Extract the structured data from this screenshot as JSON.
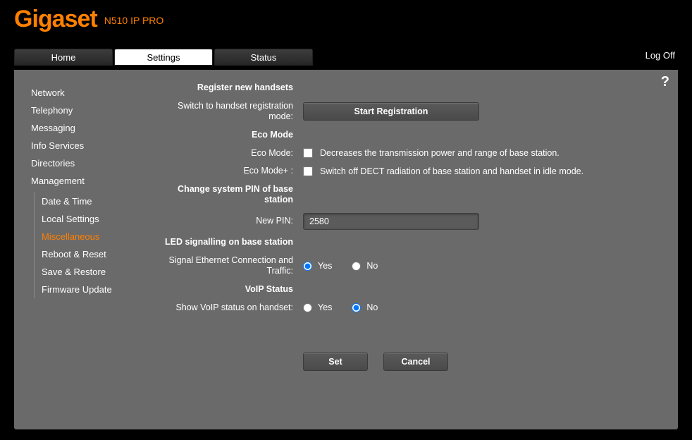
{
  "brand": "Gigaset",
  "model": "N510 IP PRO",
  "tabs": {
    "home": "Home",
    "settings": "Settings",
    "status": "Status"
  },
  "logoff": "Log Off",
  "help": "?",
  "sidebar": {
    "network": "Network",
    "telephony": "Telephony",
    "messaging": "Messaging",
    "info_services": "Info Services",
    "directories": "Directories",
    "management": "Management",
    "sub": {
      "date_time": "Date & Time",
      "local_settings": "Local Settings",
      "miscellaneous": "Miscellaneous",
      "reboot_reset": "Reboot & Reset",
      "save_restore": "Save & Restore",
      "firmware_update": "Firmware Update"
    }
  },
  "sections": {
    "register_heading": "Register new handsets",
    "switch_label": "Switch to handset registration mode:",
    "start_reg_btn": "Start Registration",
    "eco_heading": "Eco Mode",
    "eco_mode_label": "Eco Mode:",
    "eco_mode_desc": "Decreases the transmission power and range of base station.",
    "eco_mode_plus_label": "Eco Mode+ :",
    "eco_mode_plus_desc": "Switch off DECT radiation of base station and handset in idle mode.",
    "pin_heading": "Change system PIN of base station",
    "new_pin_label": "New PIN:",
    "new_pin_value": "2580",
    "led_heading": "LED signalling on base station",
    "signal_label": "Signal Ethernet Connection and Traffic:",
    "voip_heading": "VoIP Status",
    "show_voip_label": "Show VoIP status on handset:",
    "yes": "Yes",
    "no": "No",
    "set_btn": "Set",
    "cancel_btn": "Cancel"
  }
}
